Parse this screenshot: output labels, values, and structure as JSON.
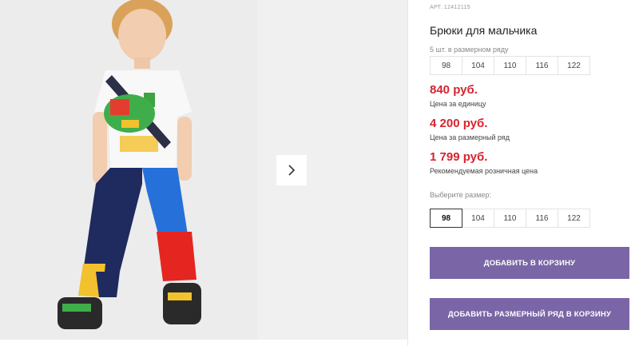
{
  "product": {
    "sku": "АРТ. 12412115",
    "title": "Брюки для мальчика"
  },
  "size_series": {
    "caption": "5 шт. в размерном ряду",
    "sizes": [
      "98",
      "104",
      "110",
      "116",
      "122"
    ]
  },
  "prices": [
    {
      "value": "840 руб.",
      "label": "Цена за единицу"
    },
    {
      "value": "4 200 руб.",
      "label": "Цена за размерный ряд"
    },
    {
      "value": "1 799 руб.",
      "label": "Рекомендуемая розничная цена"
    }
  ],
  "size_select": {
    "caption": "Выберите размер:",
    "sizes": [
      "98",
      "104",
      "110",
      "116",
      "122"
    ],
    "selected": "98"
  },
  "buttons": {
    "add_to_cart": "ДОБАВИТЬ В КОРЗИНУ",
    "add_series_to_cart": "ДОБАВИТЬ РАЗМЕРНЫЙ РЯД В КОРЗИНУ"
  },
  "colors": {
    "price": "#d6232f",
    "button": "#7a66a6"
  },
  "icons": {
    "next": "chevron-right-icon"
  }
}
